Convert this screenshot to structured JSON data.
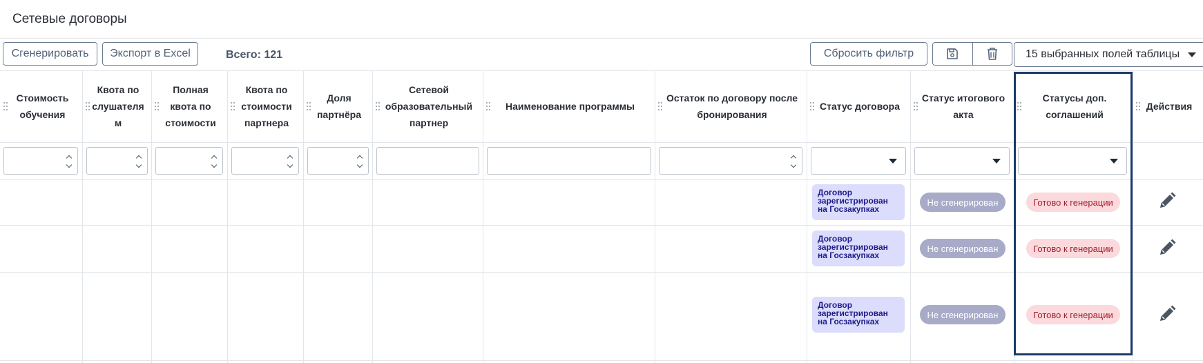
{
  "page": {
    "title": "Сетевые договоры"
  },
  "toolbar": {
    "generate_label": "Сгенерировать",
    "export_label": "Экспорт в Excel",
    "total_label": "Всего: 121",
    "reset_filter_label": "Сбросить фильтр",
    "save_icon": "save-icon",
    "delete_icon": "trash-icon",
    "fields_select_value": "15 выбранных полей таблицы"
  },
  "table": {
    "columns": [
      {
        "label": "Стоимость обучения"
      },
      {
        "label": "Квота по слушателям"
      },
      {
        "label": "Полная квота по стоимости"
      },
      {
        "label": "Квота по стоимости партнера"
      },
      {
        "label": "Доля партнёра"
      },
      {
        "label": "Сетевой образовательный партнер"
      },
      {
        "label": "Наименование программы"
      },
      {
        "label": "Остаток по договору после бронирования"
      },
      {
        "label": "Статус договора"
      },
      {
        "label": "Статус итогового акта"
      },
      {
        "label": "Статусы доп. соглашений"
      },
      {
        "label": "Действия"
      }
    ],
    "rows": [
      {
        "contract_status": "Договор зарегистрирован на Госзакупках",
        "act_status": "Не сгенерирован",
        "supplement_status": "Готово к генерации"
      },
      {
        "contract_status": "Договор зарегистрирован на Госзакупках",
        "act_status": "Не сгенерирован",
        "supplement_status": "Готово к генерации"
      },
      {
        "contract_status": "Договор зарегистрирован на Госзакупках",
        "act_status": "Не сгенерирован",
        "supplement_status": "Готово к генерации"
      }
    ],
    "row_action_icon": "pencil-icon"
  },
  "colors": {
    "contract_badge_bg": "#dcdcfc",
    "act_badge_bg": "#a8abc7",
    "ready_badge_bg": "#fbd9dc",
    "highlight_border": "#1b3a6b"
  }
}
